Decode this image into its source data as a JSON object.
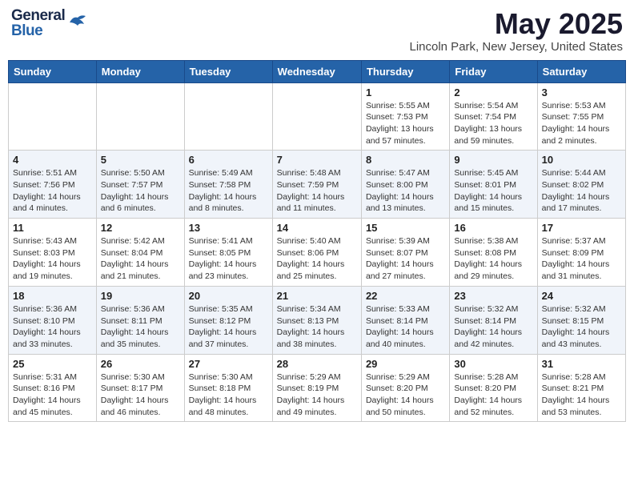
{
  "header": {
    "logo_general": "General",
    "logo_blue": "Blue",
    "title": "May 2025",
    "subtitle": "Lincoln Park, New Jersey, United States"
  },
  "days_of_week": [
    "Sunday",
    "Monday",
    "Tuesday",
    "Wednesday",
    "Thursday",
    "Friday",
    "Saturday"
  ],
  "weeks": [
    [
      {
        "day": "",
        "info": ""
      },
      {
        "day": "",
        "info": ""
      },
      {
        "day": "",
        "info": ""
      },
      {
        "day": "",
        "info": ""
      },
      {
        "day": "1",
        "info": "Sunrise: 5:55 AM\nSunset: 7:53 PM\nDaylight: 13 hours\nand 57 minutes."
      },
      {
        "day": "2",
        "info": "Sunrise: 5:54 AM\nSunset: 7:54 PM\nDaylight: 13 hours\nand 59 minutes."
      },
      {
        "day": "3",
        "info": "Sunrise: 5:53 AM\nSunset: 7:55 PM\nDaylight: 14 hours\nand 2 minutes."
      }
    ],
    [
      {
        "day": "4",
        "info": "Sunrise: 5:51 AM\nSunset: 7:56 PM\nDaylight: 14 hours\nand 4 minutes."
      },
      {
        "day": "5",
        "info": "Sunrise: 5:50 AM\nSunset: 7:57 PM\nDaylight: 14 hours\nand 6 minutes."
      },
      {
        "day": "6",
        "info": "Sunrise: 5:49 AM\nSunset: 7:58 PM\nDaylight: 14 hours\nand 8 minutes."
      },
      {
        "day": "7",
        "info": "Sunrise: 5:48 AM\nSunset: 7:59 PM\nDaylight: 14 hours\nand 11 minutes."
      },
      {
        "day": "8",
        "info": "Sunrise: 5:47 AM\nSunset: 8:00 PM\nDaylight: 14 hours\nand 13 minutes."
      },
      {
        "day": "9",
        "info": "Sunrise: 5:45 AM\nSunset: 8:01 PM\nDaylight: 14 hours\nand 15 minutes."
      },
      {
        "day": "10",
        "info": "Sunrise: 5:44 AM\nSunset: 8:02 PM\nDaylight: 14 hours\nand 17 minutes."
      }
    ],
    [
      {
        "day": "11",
        "info": "Sunrise: 5:43 AM\nSunset: 8:03 PM\nDaylight: 14 hours\nand 19 minutes."
      },
      {
        "day": "12",
        "info": "Sunrise: 5:42 AM\nSunset: 8:04 PM\nDaylight: 14 hours\nand 21 minutes."
      },
      {
        "day": "13",
        "info": "Sunrise: 5:41 AM\nSunset: 8:05 PM\nDaylight: 14 hours\nand 23 minutes."
      },
      {
        "day": "14",
        "info": "Sunrise: 5:40 AM\nSunset: 8:06 PM\nDaylight: 14 hours\nand 25 minutes."
      },
      {
        "day": "15",
        "info": "Sunrise: 5:39 AM\nSunset: 8:07 PM\nDaylight: 14 hours\nand 27 minutes."
      },
      {
        "day": "16",
        "info": "Sunrise: 5:38 AM\nSunset: 8:08 PM\nDaylight: 14 hours\nand 29 minutes."
      },
      {
        "day": "17",
        "info": "Sunrise: 5:37 AM\nSunset: 8:09 PM\nDaylight: 14 hours\nand 31 minutes."
      }
    ],
    [
      {
        "day": "18",
        "info": "Sunrise: 5:36 AM\nSunset: 8:10 PM\nDaylight: 14 hours\nand 33 minutes."
      },
      {
        "day": "19",
        "info": "Sunrise: 5:36 AM\nSunset: 8:11 PM\nDaylight: 14 hours\nand 35 minutes."
      },
      {
        "day": "20",
        "info": "Sunrise: 5:35 AM\nSunset: 8:12 PM\nDaylight: 14 hours\nand 37 minutes."
      },
      {
        "day": "21",
        "info": "Sunrise: 5:34 AM\nSunset: 8:13 PM\nDaylight: 14 hours\nand 38 minutes."
      },
      {
        "day": "22",
        "info": "Sunrise: 5:33 AM\nSunset: 8:14 PM\nDaylight: 14 hours\nand 40 minutes."
      },
      {
        "day": "23",
        "info": "Sunrise: 5:32 AM\nSunset: 8:14 PM\nDaylight: 14 hours\nand 42 minutes."
      },
      {
        "day": "24",
        "info": "Sunrise: 5:32 AM\nSunset: 8:15 PM\nDaylight: 14 hours\nand 43 minutes."
      }
    ],
    [
      {
        "day": "25",
        "info": "Sunrise: 5:31 AM\nSunset: 8:16 PM\nDaylight: 14 hours\nand 45 minutes."
      },
      {
        "day": "26",
        "info": "Sunrise: 5:30 AM\nSunset: 8:17 PM\nDaylight: 14 hours\nand 46 minutes."
      },
      {
        "day": "27",
        "info": "Sunrise: 5:30 AM\nSunset: 8:18 PM\nDaylight: 14 hours\nand 48 minutes."
      },
      {
        "day": "28",
        "info": "Sunrise: 5:29 AM\nSunset: 8:19 PM\nDaylight: 14 hours\nand 49 minutes."
      },
      {
        "day": "29",
        "info": "Sunrise: 5:29 AM\nSunset: 8:20 PM\nDaylight: 14 hours\nand 50 minutes."
      },
      {
        "day": "30",
        "info": "Sunrise: 5:28 AM\nSunset: 8:20 PM\nDaylight: 14 hours\nand 52 minutes."
      },
      {
        "day": "31",
        "info": "Sunrise: 5:28 AM\nSunset: 8:21 PM\nDaylight: 14 hours\nand 53 minutes."
      }
    ]
  ]
}
